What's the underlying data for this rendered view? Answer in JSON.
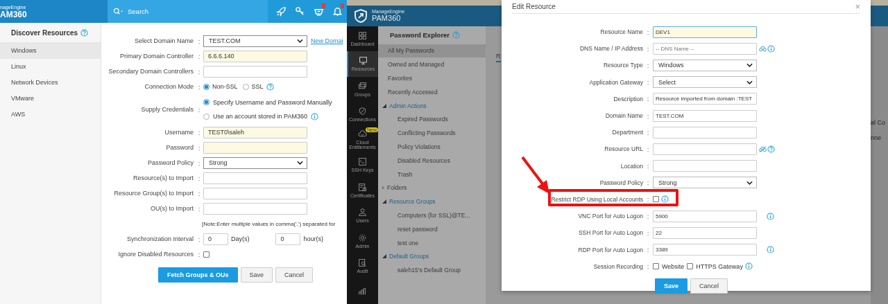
{
  "discover": {
    "logo": {
      "line1": "nageEngine",
      "line2": "AM360"
    },
    "search": {
      "placeholder": "Search"
    },
    "toolbar": [
      {
        "kind": "rocket",
        "badge": false
      },
      {
        "kind": "key",
        "badge": false
      },
      {
        "kind": "basket",
        "badge": true
      },
      {
        "kind": "bell",
        "badge": true
      }
    ],
    "sidebar": {
      "title": "Discover Resources",
      "items": [
        {
          "label": "Windows",
          "selected": true
        },
        {
          "label": "Linux",
          "selected": false
        },
        {
          "label": "Network Devices",
          "selected": false
        },
        {
          "label": "VMware",
          "selected": false
        },
        {
          "label": "AWS",
          "selected": false
        }
      ]
    },
    "form": [
      {
        "kind": "select",
        "label": "Select Domain Name",
        "sep": ":",
        "value": "TEST.COM",
        "link": "New Domai"
      },
      {
        "kind": "input",
        "label": "Primary Domain Controller",
        "sep": ":",
        "value": "6.6.6.140",
        "autofill": true
      },
      {
        "kind": "input",
        "label": "Secondary Domain Controllers",
        "sep": ":",
        "autofill": false
      },
      {
        "kind": "radio",
        "label": "Connection Mode",
        "sep": ":",
        "options": [
          {
            "label": "Non-SSL",
            "selected": true
          },
          {
            "label": "SSL",
            "selected": false
          }
        ],
        "help": true
      },
      {
        "kind": "radio-stack",
        "label": "Supply Credentials",
        "sep": ":",
        "options": [
          {
            "label": "Specify Username and Password Manually",
            "selected": true,
            "info": false
          },
          {
            "label": "Use an account stored in PAM360",
            "selected": false,
            "info": true
          }
        ]
      },
      {
        "kind": "input",
        "label": "Username",
        "sep": ":",
        "value": "TEST0\\saleh",
        "autofill": true
      },
      {
        "kind": "input",
        "label": "Password",
        "sep": ":",
        "autofill": true
      },
      {
        "kind": "select",
        "label": "Password Policy",
        "sep": ":",
        "value": "Strong"
      },
      {
        "kind": "input",
        "label": "Resource(s) to Import",
        "sep": ":",
        "autofill": false
      },
      {
        "kind": "input",
        "label": "Resource Group(s) to Import",
        "sep": ":",
        "autofill": false
      },
      {
        "kind": "input",
        "label": "OU(s) to Import",
        "sep": ":",
        "autofill": false
      },
      {
        "kind": "note",
        "text": "[Note:Enter multiple values in comma(',') separated for"
      },
      {
        "kind": "interval",
        "label": "Synchronization Interval",
        "sep": ":",
        "fields": [
          {
            "value": "0",
            "unit": "Day(s)"
          },
          {
            "value": "0",
            "unit": "hour(s)"
          }
        ]
      },
      {
        "kind": "checkbox",
        "label": "Ignore Disabled Resources",
        "sep": ":",
        "checked": false
      }
    ],
    "buttons": [
      {
        "label": "Fetch Groups & OUs",
        "primary": true
      },
      {
        "label": "Save",
        "primary": false
      },
      {
        "label": "Cancel",
        "primary": false
      }
    ]
  },
  "pam": {
    "logo": {
      "line1": "ManageEngine",
      "line2": "PAM360"
    },
    "rail": [
      {
        "kind": "dashboard",
        "label": "Dashboard",
        "selected": false
      },
      {
        "kind": "monitor",
        "label": "Resources",
        "selected": true
      },
      {
        "kind": "groups",
        "label": "Groups",
        "selected": false
      },
      {
        "kind": "connections",
        "label": "Connections",
        "selected": false
      },
      {
        "kind": "cloud",
        "label": "Cloud Entitlements",
        "selected": false,
        "badge": "New"
      },
      {
        "kind": "terminal",
        "label": "SSH Keys",
        "selected": false
      },
      {
        "kind": "certificate",
        "label": "Certificates",
        "selected": false
      },
      {
        "kind": "user",
        "label": "Users",
        "selected": false
      },
      {
        "kind": "gear",
        "label": "Admin",
        "selected": false
      },
      {
        "kind": "audit",
        "label": "Audit",
        "selected": false
      },
      {
        "kind": "chart",
        "selected": false
      }
    ],
    "explorer": {
      "title": "Password Explorer",
      "items": [
        {
          "label": "All My Passwords",
          "selected": true
        },
        {
          "label": "Owned and Managed",
          "selected": false
        },
        {
          "label": "Favorites",
          "selected": false
        },
        {
          "label": "Recently Accessed",
          "selected": false
        },
        {
          "label": "Admin Actions",
          "selected": false,
          "expanded": true,
          "children": [
            {
              "label": "Expired Passwords",
              "selected": false
            },
            {
              "label": "Conflicting Passwords",
              "selected": false
            },
            {
              "label": "Policy Violations",
              "selected": false
            },
            {
              "label": "Disabled Resources",
              "selected": false
            },
            {
              "label": "Trash",
              "selected": false
            }
          ]
        },
        {
          "label": "Folders",
          "selected": false,
          "expanded": false
        },
        {
          "label": "Resource Groups",
          "selected": false,
          "expanded": true,
          "children": [
            {
              "label": "Computers (for SSL)@TE...",
              "selected": false
            },
            {
              "label": "reset password",
              "selected": false
            },
            {
              "label": "test one",
              "selected": false
            }
          ]
        },
        {
          "label": "Default Groups",
          "selected": false,
          "expanded": true,
          "children": [
            {
              "label": "saleh15's Default Group",
              "selected": false
            }
          ]
        }
      ]
    },
    "background": {
      "tab": "R",
      "fragments": [
        "al Co",
        "nne"
      ]
    }
  },
  "modal": {
    "title": "Edit Resource",
    "close": "×",
    "rows": [
      {
        "kind": "input",
        "label": "Resource Name",
        "sep": ":",
        "value": "DEV1",
        "autofill": true
      },
      {
        "kind": "input",
        "label": "DNS Name / IP Address",
        "sep": ":",
        "placeholder": "-- DNS Name --",
        "autofill": false,
        "icons": [
          {
            "kind": "binoculars"
          },
          {
            "kind": "info"
          }
        ]
      },
      {
        "kind": "select",
        "label": "Resource Type",
        "sep": ":",
        "value": "Windows"
      },
      {
        "kind": "select",
        "label": "Application Gateway",
        "sep": ":",
        "value": "Select"
      },
      {
        "kind": "input",
        "label": "Description",
        "sep": ":",
        "value": "Resource imported from domain :TEST",
        "autofill": false
      },
      {
        "kind": "input",
        "label": "Domain Name",
        "sep": ":",
        "value": "TEST.COM",
        "autofill": false
      },
      {
        "kind": "input",
        "label": "Department",
        "sep": ":",
        "autofill": false
      },
      {
        "kind": "input",
        "label": "Resource URL",
        "sep": ":",
        "autofill": false,
        "icons": [
          {
            "kind": "binoculars-off"
          },
          {
            "kind": "help"
          }
        ]
      },
      {
        "kind": "input",
        "label": "Location",
        "sep": ":",
        "autofill": false
      },
      {
        "kind": "select",
        "label": "Password Policy",
        "sep": ":",
        "value": "Strong"
      },
      {
        "kind": "checkbox",
        "label": "Restrict RDP Using Local Accounts",
        "sep": ":",
        "checked": false,
        "icons": [
          {
            "kind": "info"
          }
        ],
        "highlight": true
      },
      {
        "kind": "input",
        "label": "VNC Port for Auto Logon",
        "sep": ":",
        "value": "5900",
        "autofill": false,
        "icons": [
          {
            "kind": "info"
          }
        ]
      },
      {
        "kind": "input",
        "label": "SSH Port for Auto Logon",
        "sep": ":",
        "value": "22",
        "autofill": false
      },
      {
        "kind": "input",
        "label": "RDP Port for Auto Logon",
        "sep": ":",
        "value": "3389",
        "autofill": false,
        "icons": [
          {
            "kind": "info"
          }
        ]
      },
      {
        "kind": "checks",
        "label": "Session Recording",
        "sep": ":",
        "options": [
          {
            "label": "Website",
            "checked": false
          },
          {
            "label": "HTTPS Gateway",
            "checked": false
          }
        ],
        "icons": [
          {
            "kind": "info"
          }
        ]
      }
    ],
    "buttons": [
      {
        "label": "Save",
        "primary": true
      },
      {
        "label": "Cancel",
        "primary": false
      }
    ]
  }
}
